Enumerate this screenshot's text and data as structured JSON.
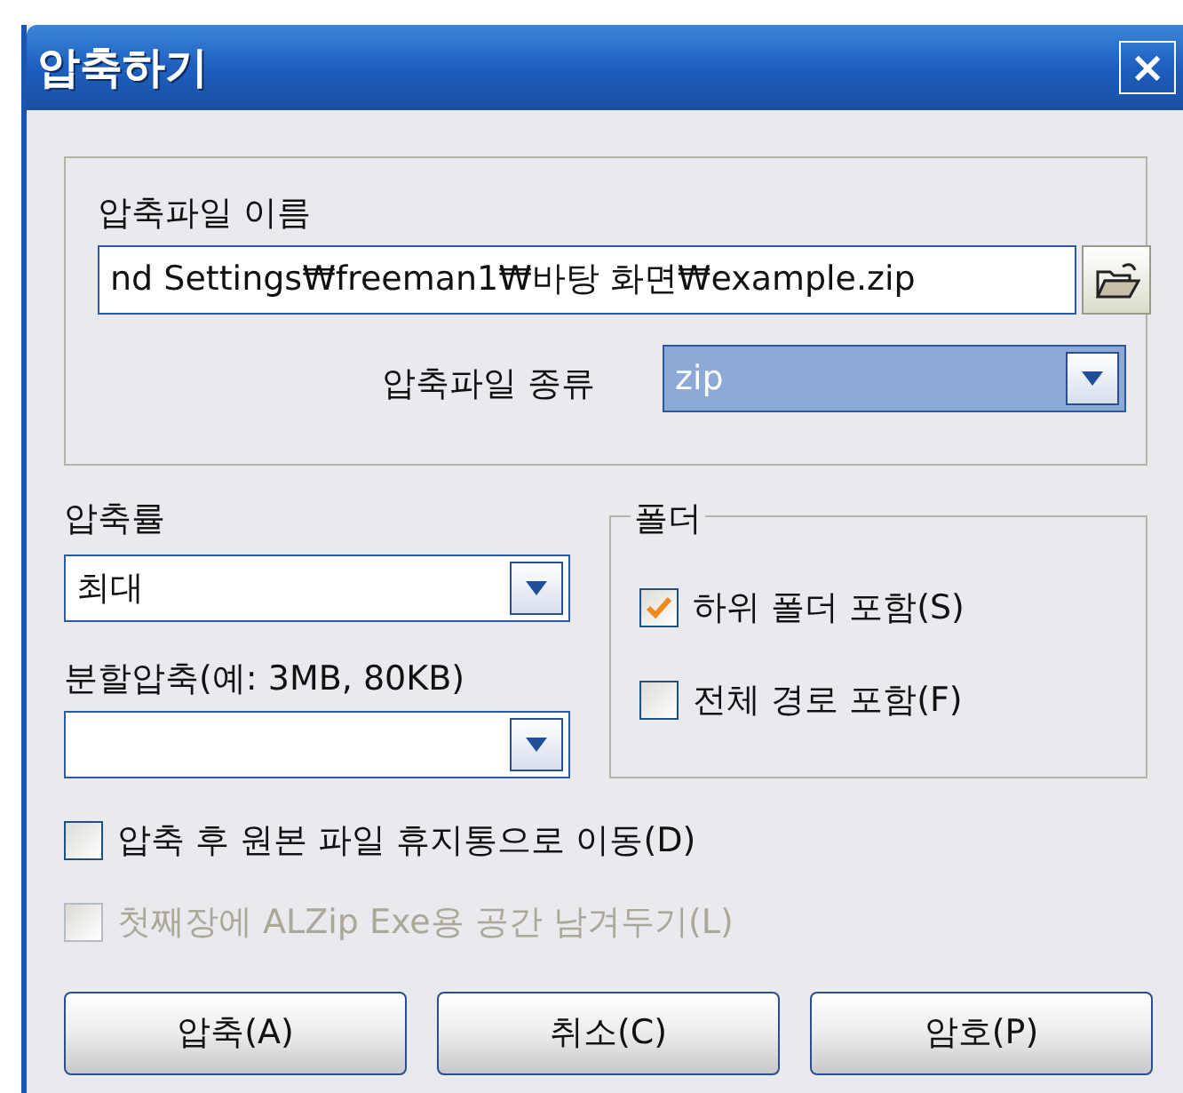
{
  "window": {
    "title": "압축하기",
    "close": "×"
  },
  "archive_name": {
    "label": "압축파일 이름",
    "value": "nd Settings₩freeman1₩바탕 화면₩example.zip"
  },
  "archive_type": {
    "label": "압축파일 종류",
    "value": "zip"
  },
  "compression_level": {
    "label": "압축률",
    "value": "최대"
  },
  "split": {
    "label": "분할압축(예: 3MB, 80KB)"
  },
  "folder_group": {
    "title": "폴더",
    "options": [
      {
        "label": "하위 폴더 포함(S)",
        "checked": true
      },
      {
        "label": "전체 경로 포함(F)",
        "checked": false
      }
    ]
  },
  "options": [
    {
      "label": "압축 후 원본 파일 휴지통으로 이동(D)",
      "checked": false,
      "disabled": false
    },
    {
      "label": "첫째장에 ALZip Exe용 공간 남겨두기(L)",
      "checked": false,
      "disabled": true
    }
  ],
  "buttons": [
    "압축(A)",
    "취소(C)",
    "암호(P)"
  ]
}
